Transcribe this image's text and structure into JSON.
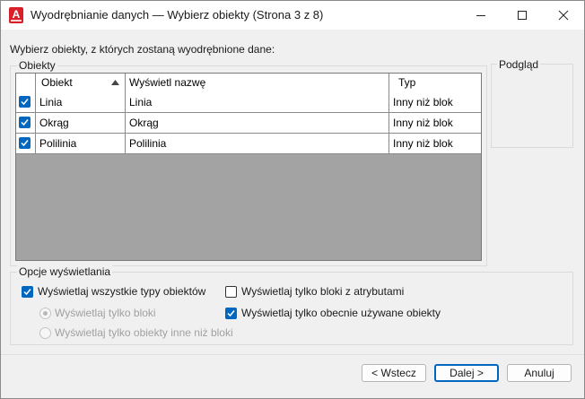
{
  "window": {
    "title": "Wyodrębnianie danych — Wybierz obiekty (Strona 3 z 8)",
    "app_icon_letter": "A",
    "controls": [
      "minimize-icon",
      "maximize-icon",
      "close-icon"
    ]
  },
  "intro_text": "Wybierz obiekty, z których zostaną wyodrębnione dane:",
  "objects_group": {
    "label": "Obiekty",
    "columns": [
      "Obiekt",
      "Wyświetl nazwę",
      "Typ"
    ],
    "sort_column": "Obiekt",
    "sort_direction": "ascending",
    "rows": [
      {
        "checked": true,
        "object": "Linia",
        "display_name": "Linia",
        "type": "Inny niż blok"
      },
      {
        "checked": true,
        "object": "Okrąg",
        "display_name": "Okrąg",
        "type": "Inny niż blok"
      },
      {
        "checked": true,
        "object": "Polilinia",
        "display_name": "Polilinia",
        "type": "Inny niż blok"
      }
    ]
  },
  "preview": {
    "label": "Podgląd"
  },
  "display_options": {
    "label": "Opcje wyświetlania",
    "show_all_types": {
      "label": "Wyświetlaj wszystkie typy obiektów",
      "checked": true
    },
    "blocks_only": {
      "label": "Wyświetlaj tylko bloki",
      "selected": true,
      "enabled": false
    },
    "non_blocks_only": {
      "label": "Wyświetlaj tylko obiekty inne niż bloki",
      "selected": false,
      "enabled": false
    },
    "attr_blocks_only": {
      "label": "Wyświetlaj tylko bloki z atrybutami",
      "checked": false
    },
    "in_use_only": {
      "label": "Wyświetlaj tylko obecnie używane obiekty",
      "checked": true
    }
  },
  "buttons": {
    "back": "< Wstecz",
    "next": "Dalej >",
    "cancel": "Anuluj"
  },
  "colors": {
    "accent": "#0067c0",
    "app_icon": "#d9202a",
    "grid_empty": "#a3a3a3"
  }
}
